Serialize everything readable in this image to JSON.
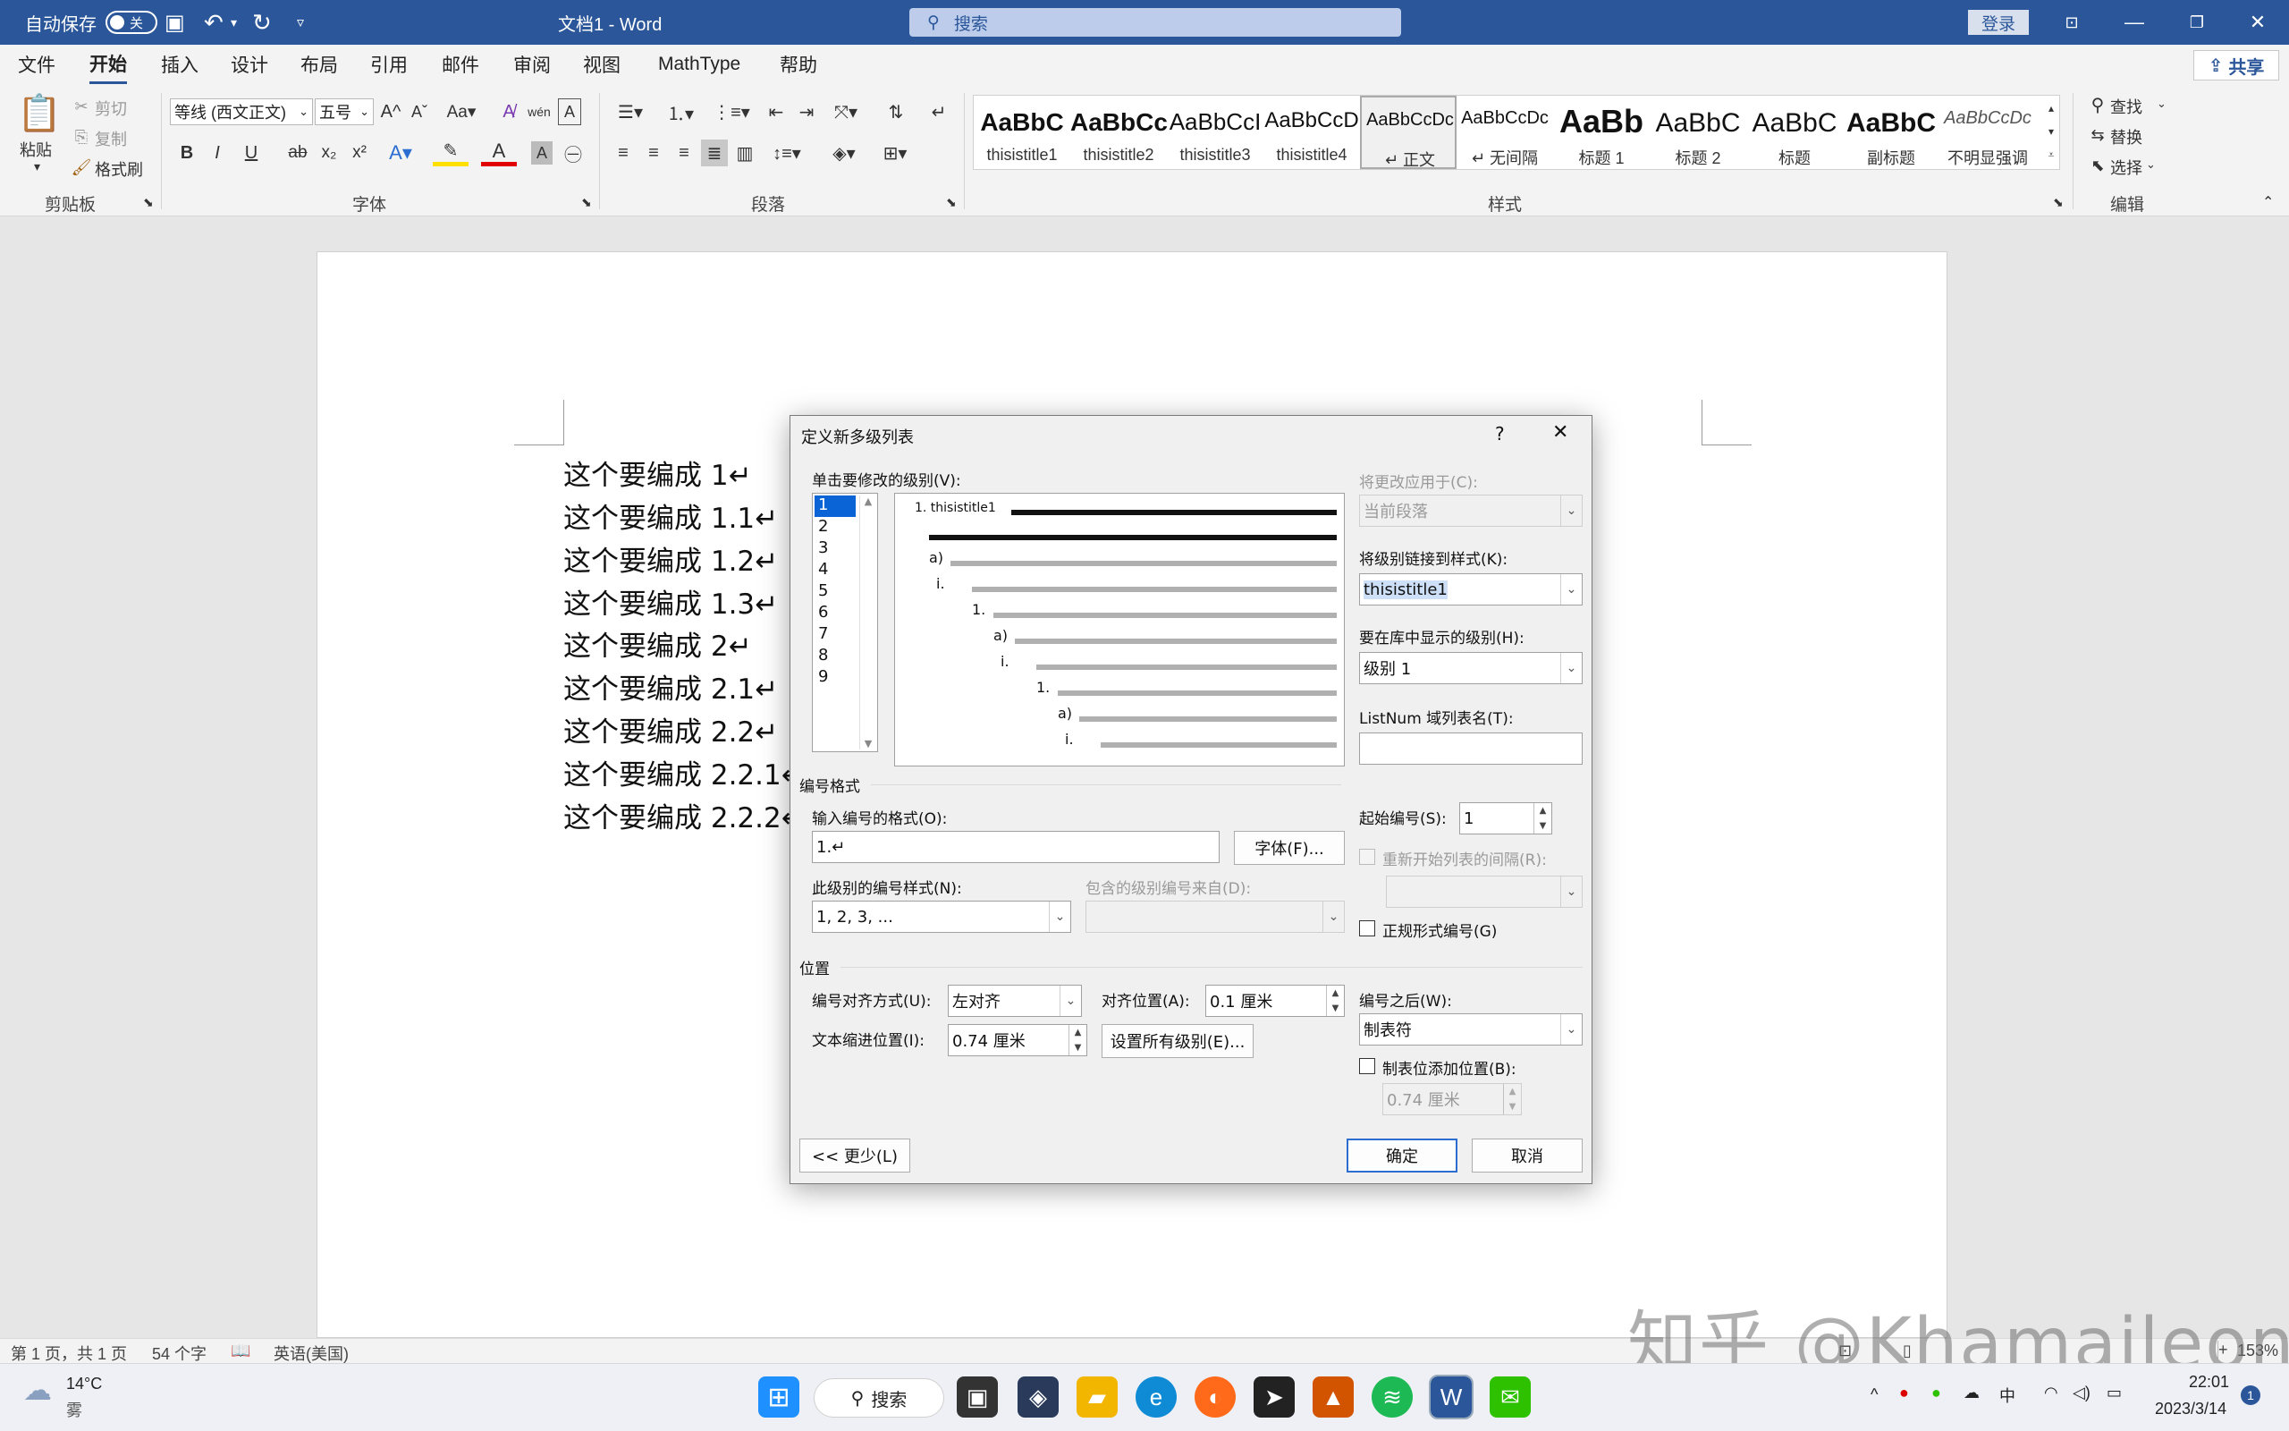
{
  "titlebar": {
    "autosave_label": "自动保存",
    "autosave_state": "关",
    "doc_title": "文档1 - Word",
    "search_placeholder": "搜索",
    "signin_label": "登录"
  },
  "ribbon_tabs": [
    "文件",
    "开始",
    "插入",
    "设计",
    "布局",
    "引用",
    "邮件",
    "审阅",
    "视图",
    "MathType",
    "帮助"
  ],
  "active_tab": "开始",
  "share_label": "共享",
  "clipboard": {
    "paste": "粘贴",
    "cut": "剪切",
    "copy": "复制",
    "format_painter": "格式刷",
    "group_label": "剪贴板"
  },
  "font": {
    "name": "等线 (西文正文)",
    "size": "五号",
    "group_label": "字体"
  },
  "paragraph": {
    "group_label": "段落"
  },
  "styles": {
    "group_label": "样式",
    "items": [
      {
        "sample": "AaBbC",
        "name": "thisistitle1"
      },
      {
        "sample": "AaBbCc",
        "name": "thisistitle2"
      },
      {
        "sample": "AaBbCcI",
        "name": "thisistitle3"
      },
      {
        "sample": "AaBbCcD",
        "name": "thisistitle4"
      },
      {
        "sample": "AaBbCcDc",
        "name": "↵ 正文"
      },
      {
        "sample": "AaBbCcDc",
        "name": "↵ 无间隔"
      },
      {
        "sample": "AaBb",
        "name": "标题 1"
      },
      {
        "sample": "AaBbC",
        "name": "标题 2"
      },
      {
        "sample": "AaBbC",
        "name": "标题"
      },
      {
        "sample": "AaBbC",
        "name": "副标题"
      },
      {
        "sample": "AaBbCcDc",
        "name": "不明显强调"
      }
    ]
  },
  "editing": {
    "find": "查找",
    "replace": "替换",
    "select": "选择",
    "group_label": "编辑"
  },
  "document": {
    "lines": [
      "这个要编成 1↵",
      "这个要编成 1.1↵",
      "这个要编成 1.2↵",
      "这个要编成 1.3↵",
      "这个要编成 2↵",
      "这个要编成 2.1↵",
      "这个要编成 2.2↵",
      "这个要编成 2.2.1↵",
      "这个要编成 2.2.2↵"
    ]
  },
  "dialog": {
    "title": "定义新多级列表",
    "help": "?",
    "close": "✕",
    "click_level_label": "单击要修改的级别(V):",
    "levels": [
      "1",
      "2",
      "3",
      "4",
      "5",
      "6",
      "7",
      "8",
      "9"
    ],
    "selected_level": "1",
    "preview": {
      "first_label": "1. thisistitle1",
      "nums": [
        "a)",
        "i.",
        "1.",
        "a)",
        "i.",
        "1.",
        "a)",
        "i."
      ]
    },
    "apply_to_label": "将更改应用于(C):",
    "apply_to_value": "当前段落",
    "link_style_label": "将级别链接到样式(K):",
    "link_style_value": "thisistitle1",
    "gallery_level_label": "要在库中显示的级别(H):",
    "gallery_level_value": "级别 1",
    "listnum_label": "ListNum 域列表名(T):",
    "listnum_value": "",
    "number_format_section": "编号格式",
    "enter_format_label": "输入编号的格式(O):",
    "enter_format_value": "1.↵",
    "font_button": "字体(F)...",
    "start_at_label": "起始编号(S):",
    "start_at_value": "1",
    "restart_label": "重新开始列表的间隔(R):",
    "restart_value": "",
    "number_style_label": "此级别的编号样式(N):",
    "number_style_value": "1, 2, 3, ...",
    "include_from_label": "包含的级别编号来自(D):",
    "include_from_value": "",
    "legal_label": "正规形式编号(G)",
    "position_section": "位置",
    "alignment_label": "编号对齐方式(U):",
    "alignment_value": "左对齐",
    "aligned_at_label": "对齐位置(A):",
    "aligned_at_value": "0.1 厘米",
    "indent_label": "文本缩进位置(I):",
    "indent_value": "0.74 厘米",
    "set_all_button": "设置所有级别(E)...",
    "follow_label": "编号之后(W):",
    "follow_value": "制表符",
    "tab_stop_label": "制表位添加位置(B):",
    "tab_stop_value": "0.74 厘米",
    "less_button": "<< 更少(L)",
    "ok_button": "确定",
    "cancel_button": "取消"
  },
  "statusbar": {
    "page": "第 1 页，共 1 页",
    "words": "54 个字",
    "language": "英语(美国)",
    "zoom": "153%"
  },
  "taskbar": {
    "weather_temp": "14°C",
    "weather_desc": "雾",
    "search_label": "搜索",
    "ime": "中",
    "time": "22:01",
    "date": "2023/3/14",
    "notif_count": "1"
  },
  "watermark": "知乎 @Khamaileon",
  "colors": {
    "word_blue": "#2b579a",
    "selection_blue": "#0a64d6"
  }
}
